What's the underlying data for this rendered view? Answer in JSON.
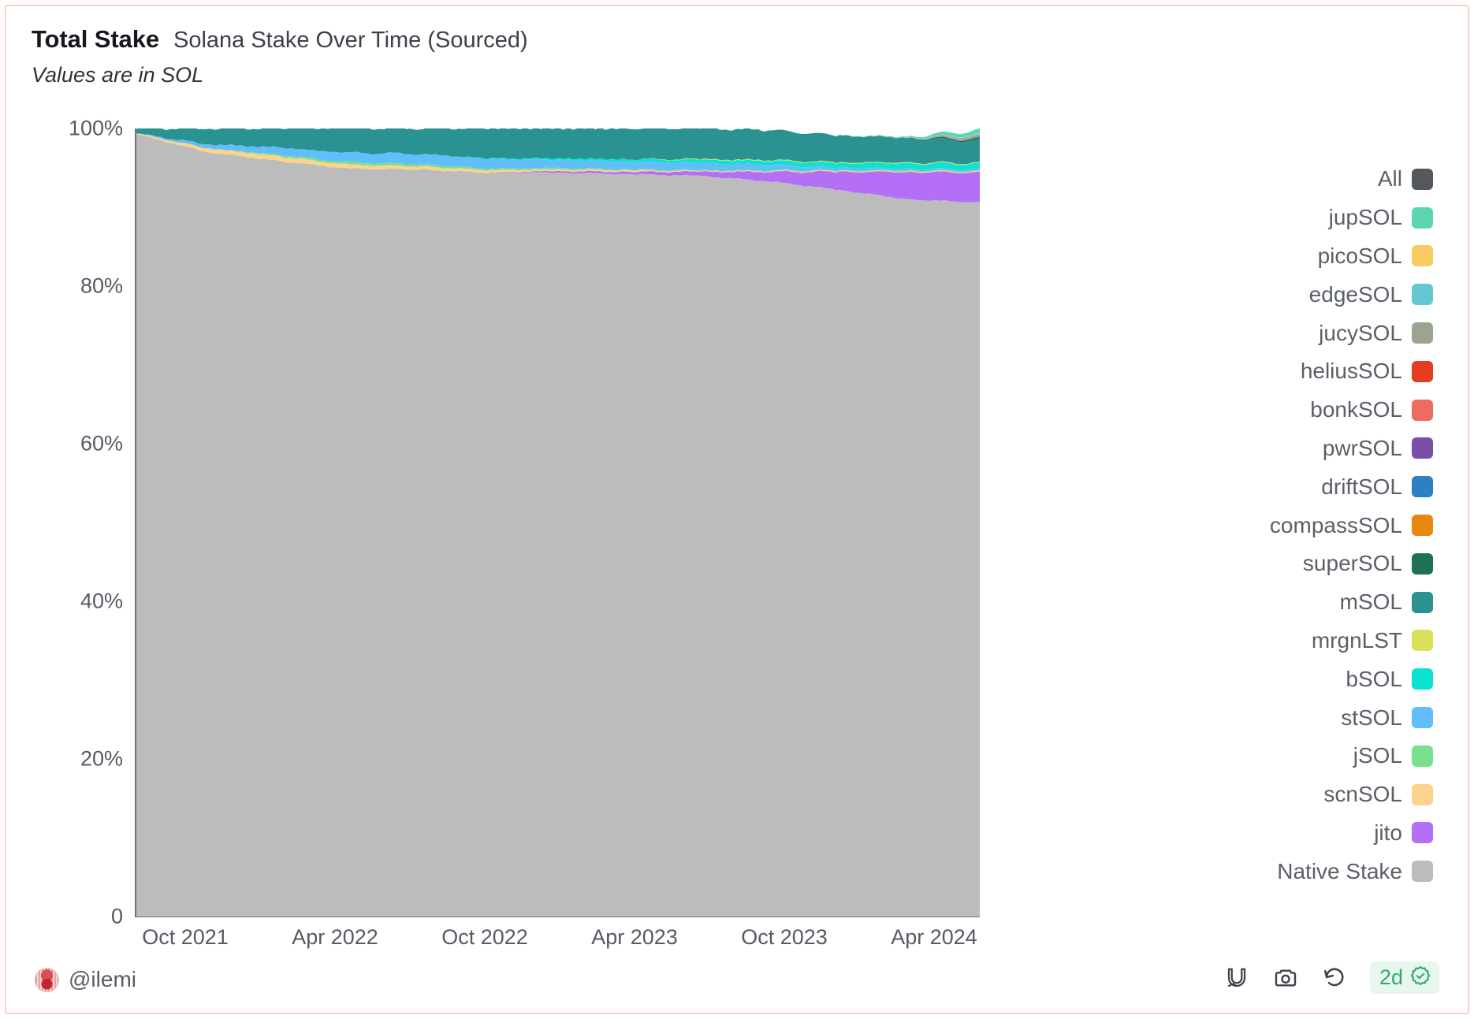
{
  "header": {
    "title_main": "Total Stake",
    "title_sub": "Solana Stake Over Time (Sourced)",
    "subtitle": "Values are in SOL"
  },
  "footer": {
    "handle": "@ilemi",
    "avatar_icon": "avatar-icon",
    "tools": [
      {
        "name": "magnet-icon",
        "label": "magnet"
      },
      {
        "name": "camera-icon",
        "label": "camera"
      },
      {
        "name": "refresh-icon",
        "label": "refresh"
      }
    ],
    "badge": {
      "text": "2d",
      "icon": "verified-badge-icon",
      "text_color": "#2faa6a",
      "bg_color": "#e8f7ee"
    }
  },
  "theme": {
    "border_color": "#f6cfc6",
    "axis_color": "#6f757e",
    "tick_text_color": "#555a63",
    "legend_text_color": "#5a5f68"
  },
  "chart_data": {
    "type": "area",
    "stacked": true,
    "normalized": true,
    "title": "Solana Stake Over Time (Sourced)",
    "subtitle": "Values are in SOL",
    "xlabel": "",
    "ylabel": "",
    "ylim": [
      0,
      100
    ],
    "grid": false,
    "legend_position": "right",
    "ytick_labels": [
      "100%",
      "80%",
      "60%",
      "40%",
      "20%",
      "0"
    ],
    "ytick_values": [
      100,
      80,
      60,
      40,
      20,
      0
    ],
    "xtick_labels": [
      "Oct 2021",
      "Apr 2022",
      "Oct 2022",
      "Apr 2023",
      "Oct 2023",
      "Apr 2024"
    ],
    "x": [
      "Jul 2021",
      "Oct 2021",
      "Jan 2022",
      "Apr 2022",
      "Jul 2022",
      "Oct 2022",
      "Jan 2023",
      "Apr 2023",
      "Jul 2023",
      "Oct 2023",
      "Jan 2024",
      "Apr 2024",
      "Jul 2024"
    ],
    "series": [
      {
        "name": "Native Stake",
        "color": "#bcbcbc",
        "values": [
          99.3,
          97.0,
          95.9,
          94.9,
          94.8,
          94.4,
          94.4,
          94.2,
          94.0,
          93.3,
          92.2,
          91.0,
          90.6
        ]
      },
      {
        "name": "jito",
        "color": "#b36ff6",
        "values": [
          0.0,
          0.0,
          0.0,
          0.0,
          0.0,
          0.0,
          0.2,
          0.3,
          0.5,
          1.2,
          2.3,
          3.5,
          3.8
        ]
      },
      {
        "name": "scnSOL",
        "color": "#fcd28c",
        "values": [
          0.1,
          0.5,
          0.6,
          0.5,
          0.4,
          0.3,
          0.2,
          0.2,
          0.1,
          0.1,
          0.1,
          0.1,
          0.1
        ]
      },
      {
        "name": "jSOL",
        "color": "#78e08f",
        "values": [
          0.0,
          0.0,
          0.2,
          0.3,
          0.3,
          0.2,
          0.2,
          0.1,
          0.1,
          0.1,
          0.1,
          0.1,
          0.1
        ]
      },
      {
        "name": "stSOL",
        "color": "#62bdfb",
        "values": [
          0.0,
          0.5,
          0.9,
          1.2,
          1.3,
          1.2,
          1.0,
          1.0,
          0.9,
          0.7,
          0.3,
          0.2,
          0.2
        ]
      },
      {
        "name": "bSOL",
        "color": "#0be3d2",
        "values": [
          0.0,
          0.0,
          0.0,
          0.0,
          0.0,
          0.1,
          0.2,
          0.3,
          0.4,
          0.5,
          0.6,
          0.7,
          0.7
        ]
      },
      {
        "name": "mrgnLST",
        "color": "#d9e05a",
        "values": [
          0.0,
          0.0,
          0.0,
          0.0,
          0.0,
          0.0,
          0.0,
          0.0,
          0.1,
          0.1,
          0.1,
          0.1,
          0.1
        ]
      },
      {
        "name": "mSOL",
        "color": "#2a9290",
        "values": [
          0.6,
          2.0,
          2.4,
          3.1,
          3.2,
          3.8,
          3.8,
          3.9,
          3.9,
          3.8,
          3.4,
          3.0,
          2.8
        ]
      },
      {
        "name": "superSOL",
        "color": "#1f7054",
        "values": [
          0.0,
          0.0,
          0.0,
          0.0,
          0.0,
          0.0,
          0.0,
          0.0,
          0.0,
          0.0,
          0.0,
          0.1,
          0.2
        ]
      },
      {
        "name": "compassSOL",
        "color": "#e8860d",
        "values": [
          0.0,
          0.0,
          0.0,
          0.0,
          0.0,
          0.0,
          0.0,
          0.0,
          0.0,
          0.0,
          0.0,
          0.0,
          0.05
        ]
      },
      {
        "name": "driftSOL",
        "color": "#2c80c4",
        "values": [
          0.0,
          0.0,
          0.0,
          0.0,
          0.0,
          0.0,
          0.0,
          0.0,
          0.0,
          0.0,
          0.0,
          0.0,
          0.05
        ]
      },
      {
        "name": "pwrSOL",
        "color": "#7b4fa8",
        "values": [
          0.0,
          0.0,
          0.0,
          0.0,
          0.0,
          0.0,
          0.0,
          0.0,
          0.0,
          0.0,
          0.0,
          0.0,
          0.05
        ]
      },
      {
        "name": "bonkSOL",
        "color": "#ef6a60",
        "values": [
          0.0,
          0.0,
          0.0,
          0.0,
          0.0,
          0.0,
          0.0,
          0.0,
          0.0,
          0.0,
          0.0,
          0.0,
          0.05
        ]
      },
      {
        "name": "heliusSOL",
        "color": "#e53c21",
        "values": [
          0.0,
          0.0,
          0.0,
          0.0,
          0.0,
          0.0,
          0.0,
          0.0,
          0.0,
          0.0,
          0.0,
          0.0,
          0.05
        ]
      },
      {
        "name": "jucySOL",
        "color": "#9aa491",
        "values": [
          0.0,
          0.0,
          0.0,
          0.0,
          0.0,
          0.0,
          0.0,
          0.0,
          0.0,
          0.0,
          0.0,
          0.0,
          0.05
        ]
      },
      {
        "name": "edgeSOL",
        "color": "#64c8d4",
        "values": [
          0.0,
          0.0,
          0.0,
          0.0,
          0.0,
          0.0,
          0.0,
          0.0,
          0.0,
          0.0,
          0.0,
          0.1,
          0.2
        ]
      },
      {
        "name": "picoSOL",
        "color": "#f7cd62",
        "values": [
          0.0,
          0.0,
          0.0,
          0.0,
          0.0,
          0.0,
          0.0,
          0.0,
          0.0,
          0.0,
          0.0,
          0.0,
          0.05
        ]
      },
      {
        "name": "jupSOL",
        "color": "#5bd6b0",
        "values": [
          0.0,
          0.0,
          0.0,
          0.0,
          0.0,
          0.0,
          0.0,
          0.0,
          0.0,
          0.0,
          0.0,
          0.1,
          0.6
        ]
      }
    ]
  },
  "legend": {
    "items": [
      {
        "label": "All",
        "color": "#54575c"
      },
      {
        "label": "jupSOL",
        "color": "#5bd6b0"
      },
      {
        "label": "picoSOL",
        "color": "#f7cd62"
      },
      {
        "label": "edgeSOL",
        "color": "#64c8d4"
      },
      {
        "label": "jucySOL",
        "color": "#9aa491"
      },
      {
        "label": "heliusSOL",
        "color": "#e53c21"
      },
      {
        "label": "bonkSOL",
        "color": "#ef6a60"
      },
      {
        "label": "pwrSOL",
        "color": "#7b4fa8"
      },
      {
        "label": "driftSOL",
        "color": "#2c80c4"
      },
      {
        "label": "compassSOL",
        "color": "#e8860d"
      },
      {
        "label": "superSOL",
        "color": "#1f7054"
      },
      {
        "label": "mSOL",
        "color": "#2a9290"
      },
      {
        "label": "mrgnLST",
        "color": "#d9e05a"
      },
      {
        "label": "bSOL",
        "color": "#0be3d2"
      },
      {
        "label": "stSOL",
        "color": "#62bdfb"
      },
      {
        "label": "jSOL",
        "color": "#78e08f"
      },
      {
        "label": "scnSOL",
        "color": "#fcd28c"
      },
      {
        "label": "jito",
        "color": "#b36ff6"
      },
      {
        "label": "Native Stake",
        "color": "#bcbcbc"
      }
    ]
  }
}
